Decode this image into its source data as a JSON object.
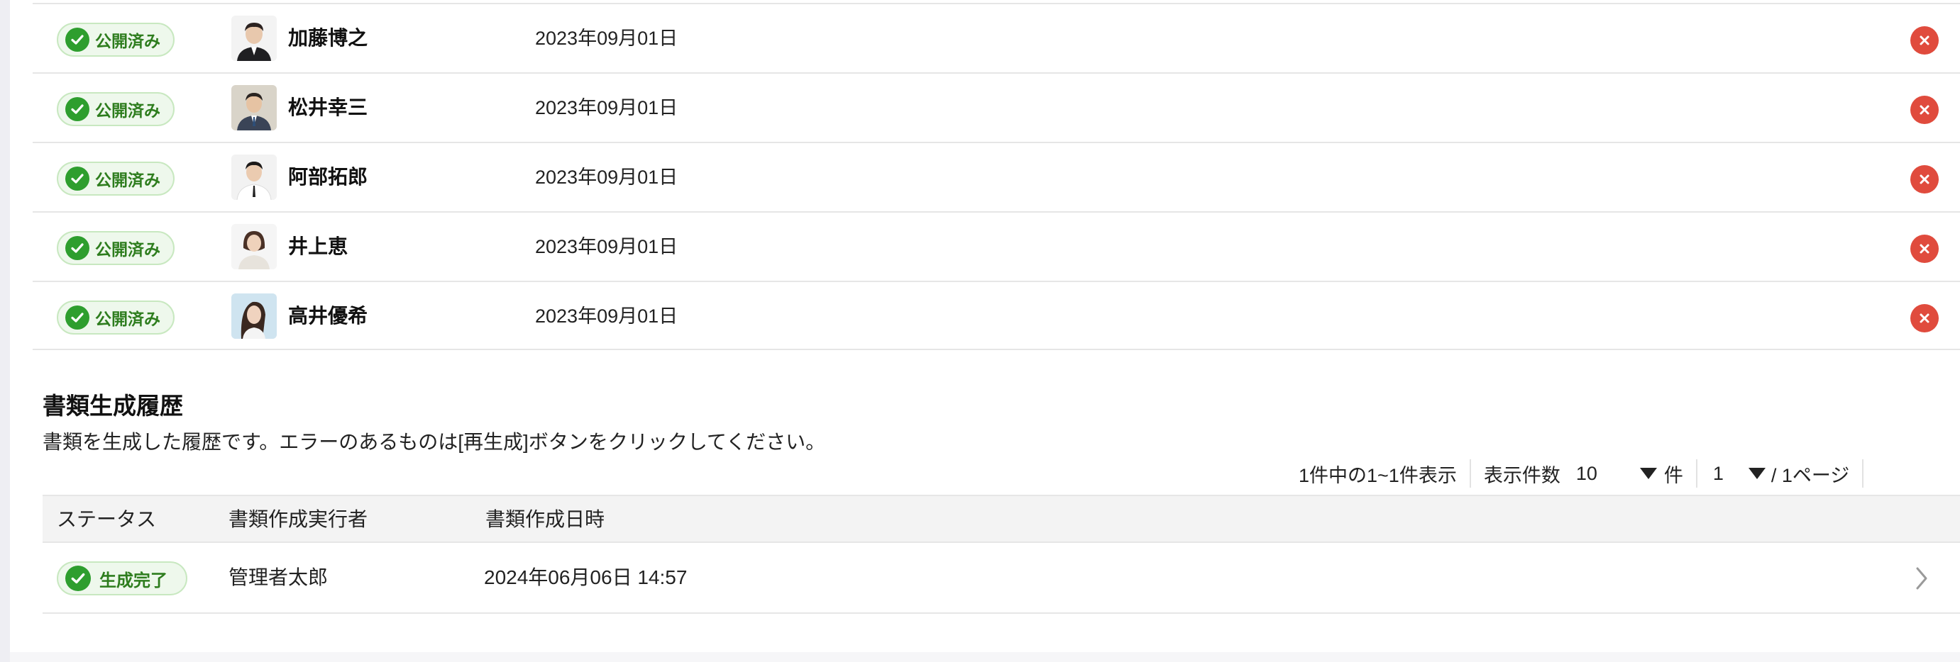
{
  "members": {
    "rows": [
      {
        "status": "公開済み",
        "name": "加藤博之",
        "date": "2023年09月01日",
        "avatar_icon": "person-photo-icon"
      },
      {
        "status": "公開済み",
        "name": "松井幸三",
        "date": "2023年09月01日",
        "avatar_icon": "person-photo-icon"
      },
      {
        "status": "公開済み",
        "name": "阿部拓郎",
        "date": "2023年09月01日",
        "avatar_icon": "person-photo-icon"
      },
      {
        "status": "公開済み",
        "name": "井上恵",
        "date": "2023年09月01日",
        "avatar_icon": "person-photo-icon"
      },
      {
        "status": "公開済み",
        "name": "高井優希",
        "date": "2023年09月01日",
        "avatar_icon": "person-photo-icon"
      }
    ]
  },
  "history": {
    "title": "書類生成履歴",
    "description": "書類を生成した履歴です。エラーのあるものは[再生成]ボタンをクリックしてください。",
    "pager": {
      "summary": "1件中の1~1件表示",
      "per_page_label": "表示件数",
      "per_page_value": "10",
      "per_page_unit": "件",
      "page_value": "1",
      "page_total": "/ 1ページ"
    },
    "columns": [
      "ステータス",
      "書類作成実行者",
      "書類作成日時"
    ],
    "rows": [
      {
        "status": "生成完了",
        "executor": "管理者太郎",
        "datetime": "2024年06月06日 14:57"
      }
    ]
  },
  "colors": {
    "success_green": "#2e9e2e",
    "success_bg": "#eef8ec",
    "delete_red": "#e04b3d"
  }
}
